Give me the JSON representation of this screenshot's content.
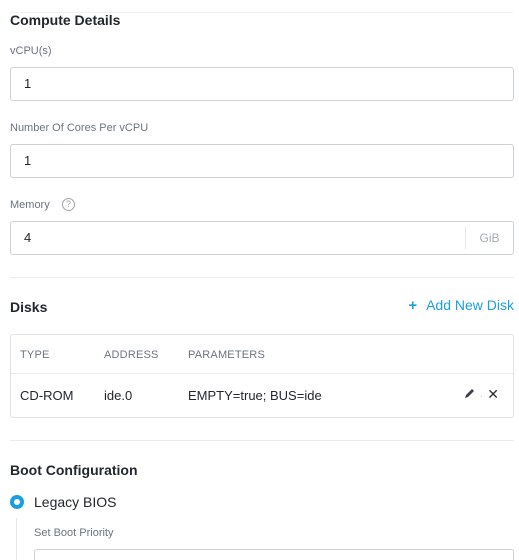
{
  "compute": {
    "title": "Compute Details",
    "vcpus_label": "vCPU(s)",
    "vcpus_value": "1",
    "cores_label": "Number Of Cores Per vCPU",
    "cores_value": "1",
    "memory_label": "Memory",
    "memory_value": "4",
    "memory_unit": "GiB",
    "help_symbol": "?"
  },
  "disks": {
    "title": "Disks",
    "add_label": "Add New Disk",
    "add_symbol": "+",
    "columns": [
      "TYPE",
      "ADDRESS",
      "PARAMETERS"
    ],
    "rows": [
      {
        "type": "CD-ROM",
        "address": "ide.0",
        "parameters": "EMPTY=true; BUS=ide"
      }
    ],
    "action_separator": "·",
    "delete_symbol": "✕"
  },
  "boot": {
    "title": "Boot Configuration",
    "option_label": "Legacy BIOS",
    "priority_label": "Set Boot Priority"
  },
  "colors": {
    "accent": "#1b9ee0",
    "text": "#22272e",
    "muted": "#6b7480",
    "border": "#cdd2d8"
  }
}
